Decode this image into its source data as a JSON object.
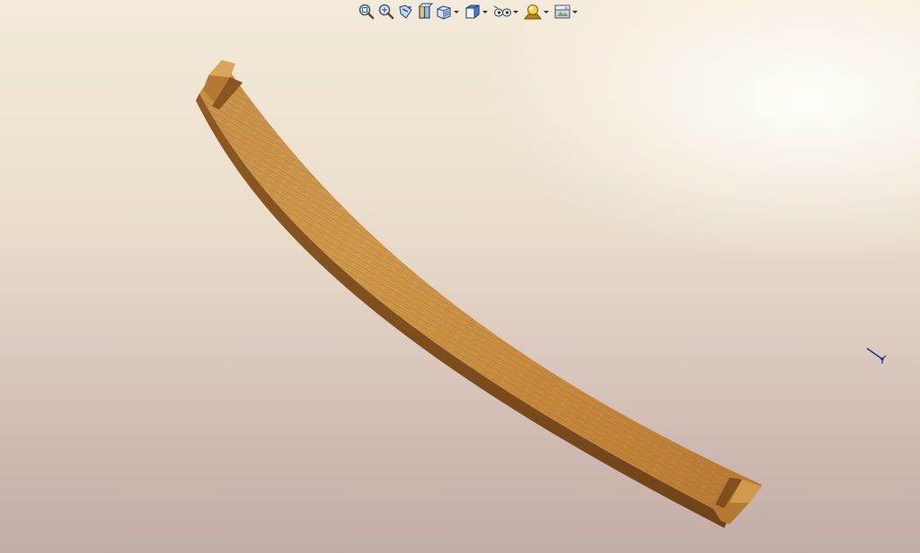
{
  "window": {
    "title": ""
  },
  "toolbar": {
    "buttons": [
      {
        "icon": "zoom-to-fit-icon",
        "has_dropdown": false
      },
      {
        "icon": "zoom-to-area-icon",
        "has_dropdown": false
      },
      {
        "icon": "previous-view-icon",
        "has_dropdown": false
      },
      {
        "icon": "section-view-icon",
        "has_dropdown": false
      },
      {
        "icon": "view-orientation-icon",
        "has_dropdown": true
      },
      {
        "icon": "display-style-icon",
        "has_dropdown": true
      },
      {
        "icon": "hide-show-items-icon",
        "has_dropdown": true
      },
      {
        "icon": "edit-appearance-icon",
        "has_dropdown": true
      },
      {
        "icon": "apply-scene-icon",
        "has_dropdown": true
      }
    ]
  },
  "model": {
    "part": "curved-wooden-slat",
    "material_color": "#c98f3e",
    "shadow_color": "#7a4e1c"
  },
  "triad": {
    "icon": "coordinate-triad-icon"
  }
}
